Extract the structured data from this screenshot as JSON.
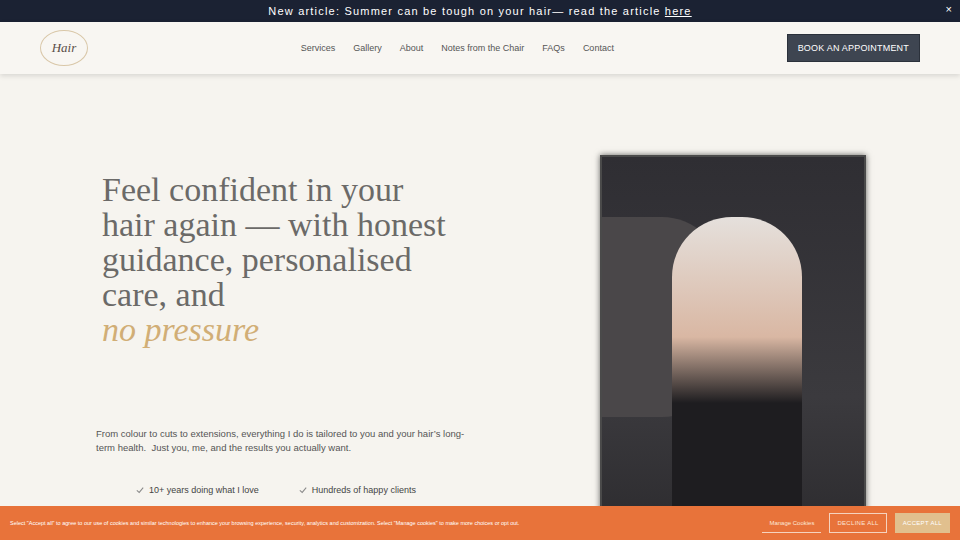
{
  "announcement": {
    "text": "New article: Summer can be tough on your hair— read the article ",
    "link": "here",
    "close": "×"
  },
  "logo": {
    "text": "Hair"
  },
  "nav": [
    "Services",
    "Gallery",
    "About",
    "Notes from the Chair",
    "FAQs",
    "Contact"
  ],
  "cta": "BOOK AN APPOINTMENT",
  "hero": {
    "heading": "Feel confident in your hair again — with honest guidance, personalised care, and",
    "accent": "no pressure",
    "body": "From colour to cuts to extensions, everything I do is tailored to you and your hair’s long-term health.  Just you, me, and the results you actually want.",
    "highlights": [
      "10+ years doing what I love",
      "Hundreds of happy clients"
    ]
  },
  "cookies": {
    "text": "Select \"Accept all\" to agree to our use of cookies and similar technologies to enhance your browsing experience, security, analytics and customization. Select \"Manage cookies\" to make more choices or opt out.",
    "buttons": [
      {
        "label": "Manage Cookies",
        "kind": "link"
      },
      {
        "label": "DECLINE ALL",
        "kind": "outline"
      },
      {
        "label": "ACCEPT ALL",
        "kind": "filled"
      }
    ]
  }
}
